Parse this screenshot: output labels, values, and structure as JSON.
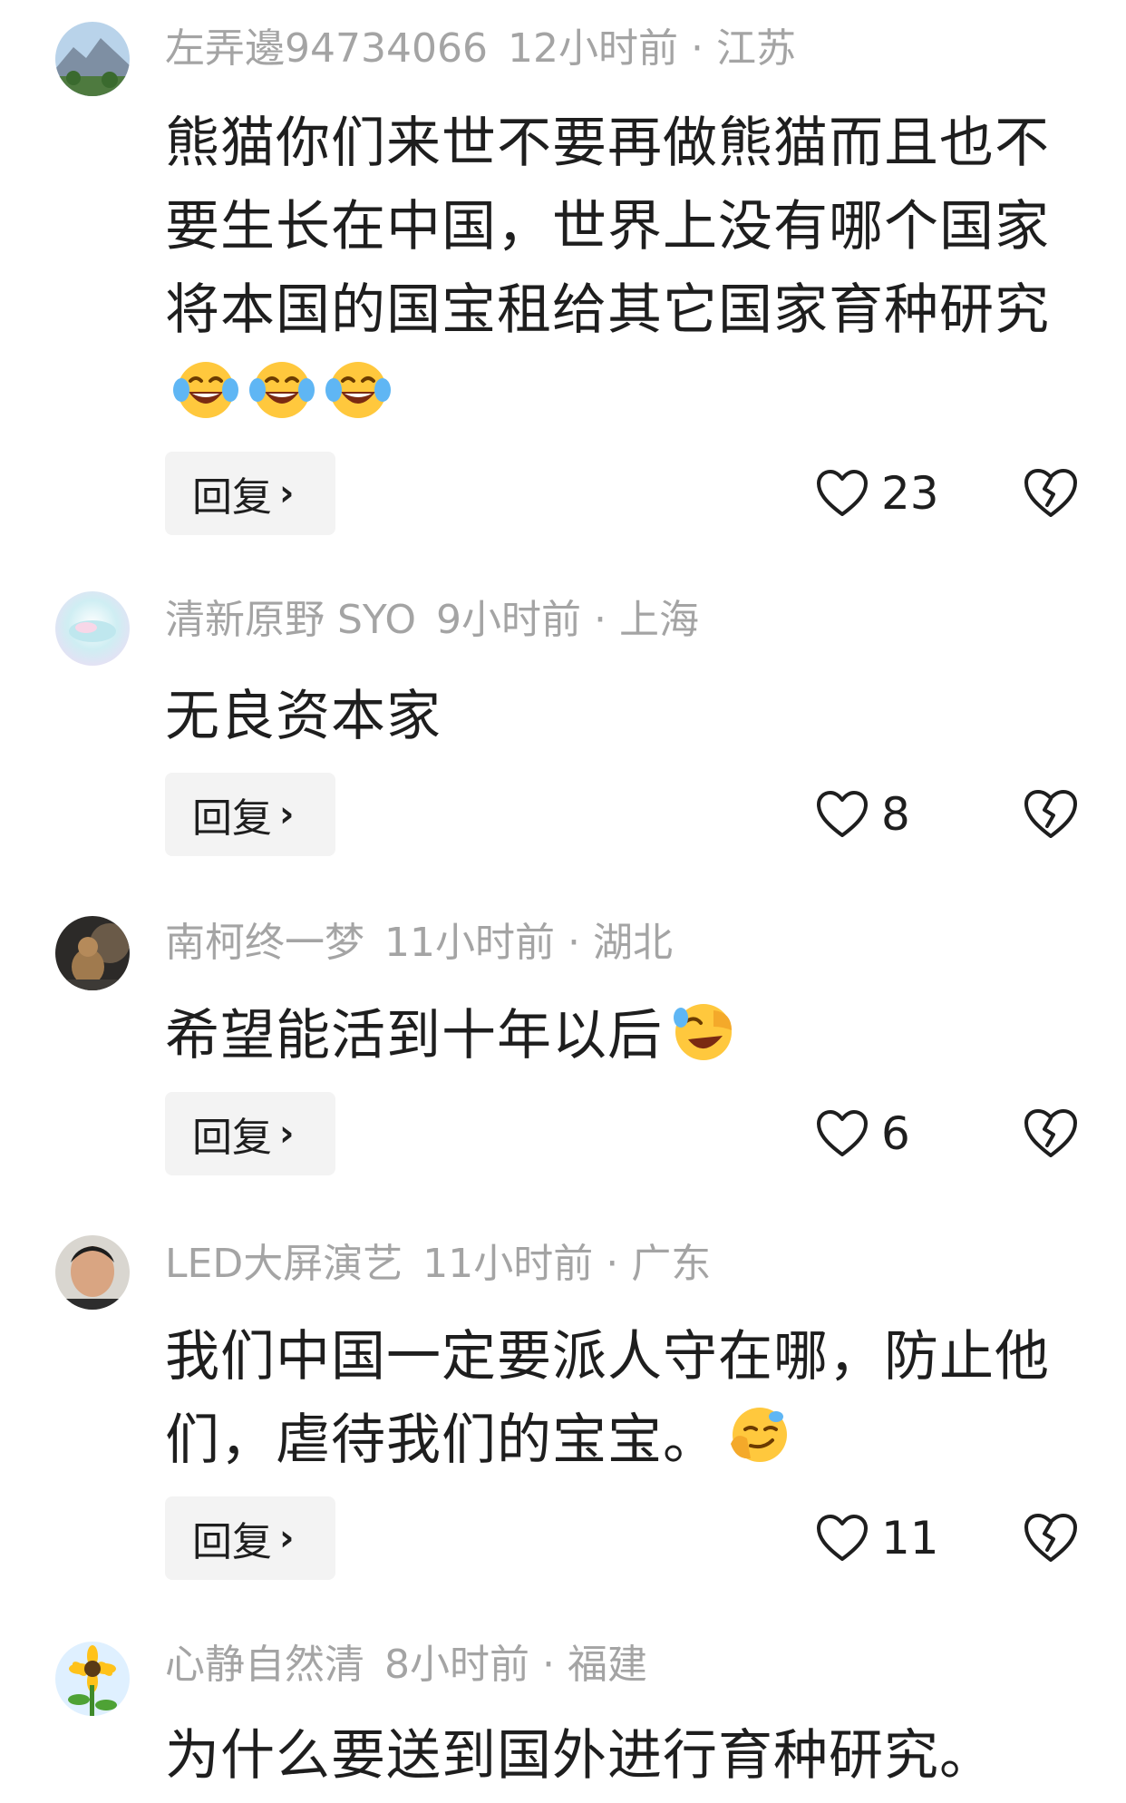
{
  "comments": [
    {
      "username": "左弄邊94734066",
      "time": "12小时前",
      "location": "江苏",
      "text": "熊猫你们来世不要再做熊猫而且也不要生长在中国，世界上没有哪个国家将本国的国宝租给其它国家育种研究",
      "emojis": [
        "laugh-cry-emoji",
        "laugh-cry-emoji",
        "laugh-cry-emoji"
      ],
      "reply_label": "回复",
      "likes": "23"
    },
    {
      "username": "清新原野 SYO",
      "time": "9小时前",
      "location": "上海",
      "text": "无良资本家",
      "emojis": [],
      "reply_label": "回复",
      "likes": "8"
    },
    {
      "username": "南柯终一梦",
      "time": "11小时前",
      "location": "湖北",
      "text": "希望能活到十年以后",
      "emojis": [
        "rofl-emoji"
      ],
      "reply_label": "回复",
      "likes": "6"
    },
    {
      "username": "LED大屏演艺",
      "time": "11小时前",
      "location": "广东",
      "text": "我们中国一定要派人守在哪，防止他们，虐待我们的宝宝。",
      "emojis": [
        "smirk-emoji"
      ],
      "reply_label": "回复",
      "likes": "11"
    },
    {
      "username": "心静自然清",
      "time": "8小时前",
      "location": "福建",
      "text": "为什么要送到国外进行育种研究。",
      "emojis": []
    }
  ],
  "separator": "·",
  "colors": {
    "meta": "#a4a4a4",
    "text": "#1e1e1e",
    "reply_bg": "#f3f3f3"
  },
  "icons": {
    "like": "heart-outline-icon",
    "dislike": "broken-heart-outline-icon",
    "reply_chevron": "chevron-right-icon"
  }
}
